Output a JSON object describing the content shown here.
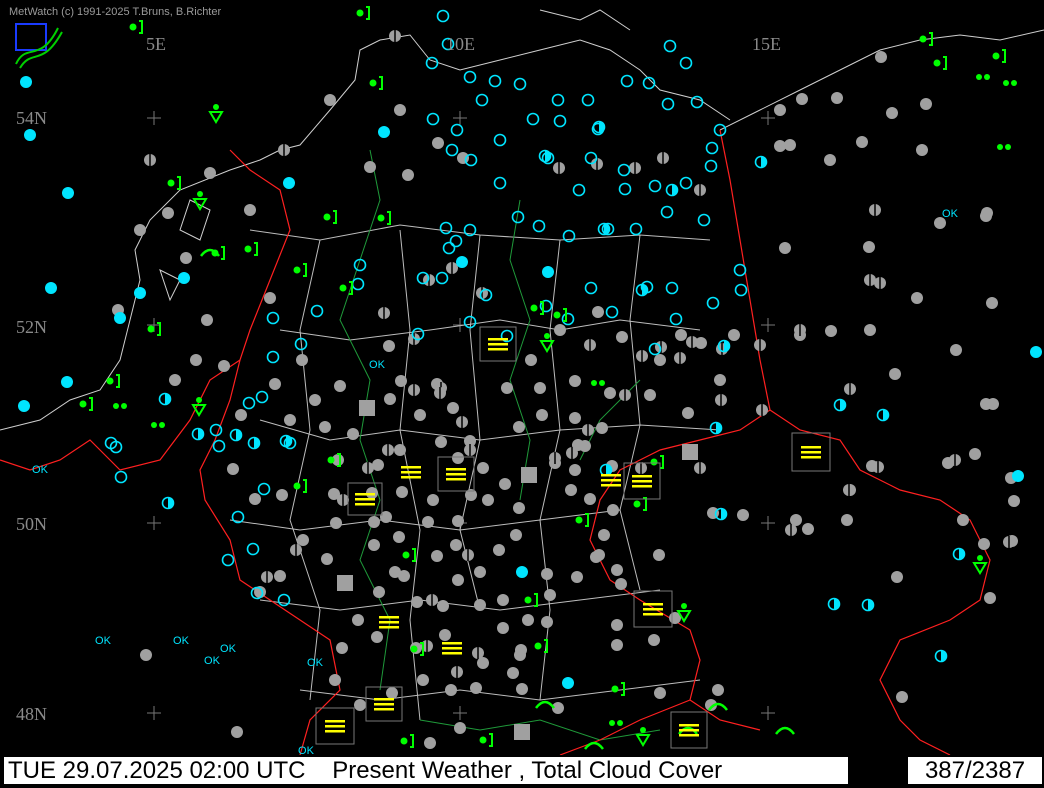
{
  "credit": "MetWatch  (c) 1991-2025 T.Bruns, B.Richter",
  "grid_labels": {
    "lon_5": "5E",
    "lon_10": "10E",
    "lon_15": "15E",
    "lat_54": "54N",
    "lat_52": "52N",
    "lat_50": "50N",
    "lat_48": "48N"
  },
  "status": {
    "datetime": "TUE 29.07.2025 02:00 UTC",
    "product": "Present Weather    , Total Cloud Cover",
    "count": "387/2387"
  },
  "ok_text": "OK",
  "colors": {
    "background": "#000000",
    "border": "#ff0000",
    "state_lines": "#ffffff",
    "rivers": "#1f9a3a",
    "clear_sky": "#00e5ff",
    "overcast": "#a0a0a0",
    "precipitation": "#00ff00",
    "fog": "#ffff00"
  },
  "station_legend": {
    "cyan-circle": "clear / partly clouded (cyan)",
    "gray-circle": "overcast (gray)",
    "green-rain": "precipitation symbols (green)",
    "yellow-fog": "fog symbols (yellow)"
  }
}
